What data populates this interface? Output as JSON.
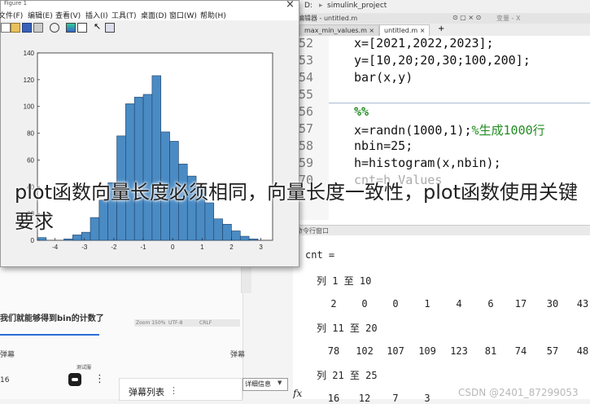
{
  "editor": {
    "path_segments": [
      "D:",
      "simulink_project"
    ],
    "title": "编辑器 - untitled.m",
    "variables_panel": "变量 - X",
    "tabs": [
      {
        "label": "max_min_values.m",
        "active": false
      },
      {
        "label": "untitled.m",
        "active": true
      }
    ],
    "lines": [
      {
        "num": "52",
        "code": "x=[2021,2022,2023];"
      },
      {
        "num": "53",
        "code": "y=[10,20;20,30;100,200];"
      },
      {
        "num": "54",
        "code": "bar(x,y)"
      },
      {
        "num": "55",
        "code": ""
      },
      {
        "num": "56",
        "code": "%%"
      },
      {
        "num": "57",
        "code": "x=randn(1000,1);",
        "comment": "%生成1000行"
      },
      {
        "num": "58",
        "code": "nbin=25;"
      },
      {
        "num": "59",
        "code": "h=histogram(x,nbin);"
      },
      {
        "num": "70",
        "code": "cnt=h.Values"
      }
    ]
  },
  "command_window": {
    "header": "命令行窗口",
    "var_line": "cnt =",
    "groups": [
      {
        "label": "列 1 至 10",
        "values": [
          "2",
          "0",
          "0",
          "1",
          "4",
          "6",
          "17",
          "30",
          "43"
        ]
      },
      {
        "label": "列 11 至 20",
        "values": [
          "78",
          "102",
          "107",
          "109",
          "123",
          "81",
          "74",
          "57",
          "48"
        ]
      },
      {
        "label": "列 21 至 25",
        "values": [
          "16",
          "12",
          "7",
          "3"
        ]
      }
    ],
    "fx": "fx"
  },
  "figure_window": {
    "title": "Figure 1",
    "close_glyph": "×",
    "menu": [
      "文件(F)",
      "编辑(E)",
      "查看(V)",
      "插入(I)",
      "工具(T)",
      "桌面(D)",
      "窗口(W)",
      "帮助(H)"
    ],
    "toolbar_icons": [
      "new-figure-icon",
      "open-icon",
      "save-icon",
      "print-icon",
      "zoom-icon",
      "insert-colorbar-icon",
      "insert-legend-icon",
      "pointer-icon",
      "property-editor-icon"
    ]
  },
  "background_app": {
    "promo_text": "我们就能够得到bin的计数了",
    "tab_label": "弹幕",
    "tab_right": "弹幕",
    "row_number": "16",
    "badge_text": "测试服",
    "danmaku_label": "弹幕列表",
    "detail_label": "详细信息",
    "status_items": [
      "Zoom 150%",
      "UTF-8",
      "CRLF"
    ]
  },
  "overlay": {
    "text": "plot函数向量长度必须相同，向量长度一致性，plot函数使用关键要求"
  },
  "watermark": "CSDN @2401_87299053",
  "chart_data": {
    "type": "bar",
    "subtype": "histogram",
    "bin_edges": [
      -4.6,
      -4.3,
      -4.0,
      -3.7,
      -3.4,
      -3.1,
      -2.8,
      -2.5,
      -2.2,
      -1.9,
      -1.6,
      -1.3,
      -1.0,
      -0.7,
      -0.4,
      -0.1,
      0.2,
      0.5,
      0.8,
      1.1,
      1.4,
      1.7,
      2.0,
      2.3,
      2.6,
      2.9
    ],
    "values": [
      2,
      0,
      0,
      1,
      4,
      6,
      17,
      30,
      43,
      78,
      102,
      107,
      109,
      123,
      81,
      74,
      57,
      48,
      40,
      28,
      16,
      12,
      7,
      3,
      1
    ],
    "xticks": [
      -4,
      -3,
      -2,
      -1,
      0,
      1,
      2,
      3
    ],
    "yticks": [
      0,
      20,
      40,
      60,
      80,
      100,
      120,
      140
    ],
    "xlim": [
      -4.6,
      3.4
    ],
    "ylim": [
      0,
      140
    ],
    "bar_color": "#4a8bc4",
    "edge_color": "#1e3f66",
    "grid": false,
    "legend": "none",
    "title": "",
    "xlabel": "",
    "ylabel": ""
  }
}
